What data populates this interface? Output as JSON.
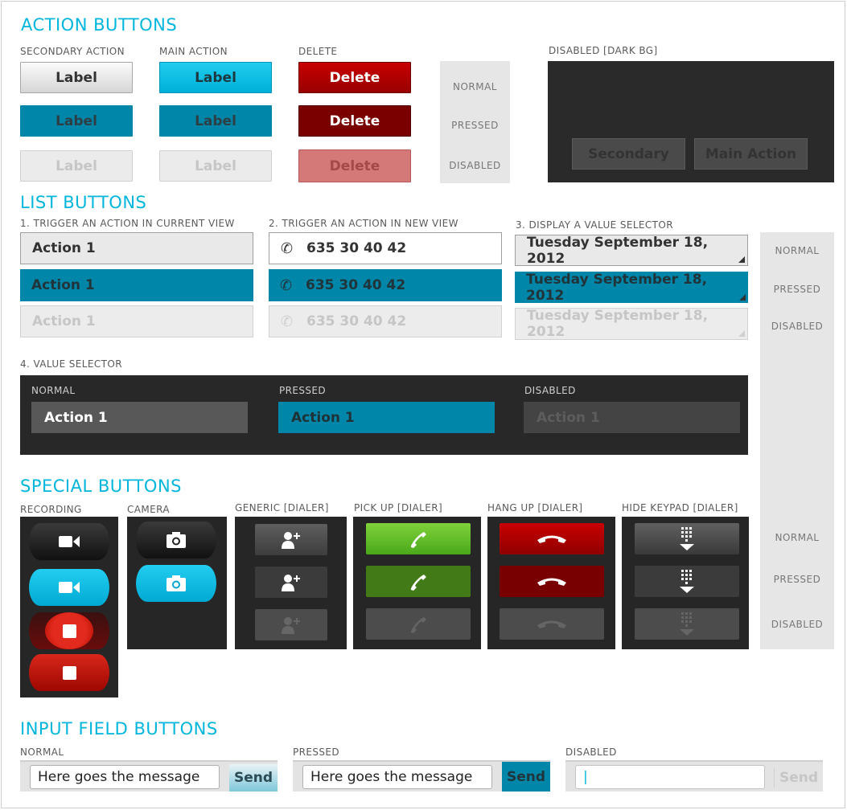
{
  "sections": {
    "action_buttons": "ACTION BUTTONS",
    "list_buttons": "LIST BUTTONS",
    "special_buttons": "SPECIAL BUTTONS",
    "input_field_buttons": "INPUT FIELD BUTTONS"
  },
  "action": {
    "secondary_caption": "SECONDARY ACTION",
    "main_caption": "MAIN ACTION",
    "delete_caption": "DELETE",
    "disabled_dark_caption": "DISABLED [DARK BG]",
    "label": "Label",
    "delete_label": "Delete",
    "dark_secondary": "Secondary",
    "dark_main": "Main Action",
    "states": [
      "NORMAL",
      "PRESSED",
      "DISABLED"
    ]
  },
  "list": {
    "caption_1": "1. TRIGGER AN ACTION IN CURRENT VIEW",
    "caption_2": "2. TRIGGER AN ACTION IN NEW VIEW",
    "caption_3": "3. DISPLAY A VALUE SELECTOR",
    "caption_4": "4. VALUE SELECTOR",
    "action_label": "Action 1",
    "phone_number": "635 30 40 42",
    "date_value": "Tuesday September 18, 2012",
    "states": [
      "NORMAL",
      "PRESSED",
      "DISABLED"
    ],
    "vs_states": [
      "NORMAL",
      "PRESSED",
      "DISABLED"
    ]
  },
  "special": {
    "recording": "RECORDING",
    "camera": "CAMERA",
    "generic": "GENERIC [DIALER]",
    "pickup": "PICK UP [DIALER]",
    "hangup": "HANG UP [DIALER]",
    "hide_keypad": "HIDE KEYPAD [DIALER]",
    "states": [
      "NORMAL",
      "PRESSED",
      "DISABLED"
    ]
  },
  "input": {
    "normal_caption": "NORMAL",
    "pressed_caption": "PRESSED",
    "disabled_caption": "DISABLED",
    "message": "Here goes the message",
    "send": "Send",
    "cursor": "|"
  },
  "colors": {
    "accent": "#00b6dc",
    "pressed": "#0086a8",
    "delete": "#b30000",
    "pickup": "#5cbd1c",
    "dark_panel": "#262626"
  }
}
